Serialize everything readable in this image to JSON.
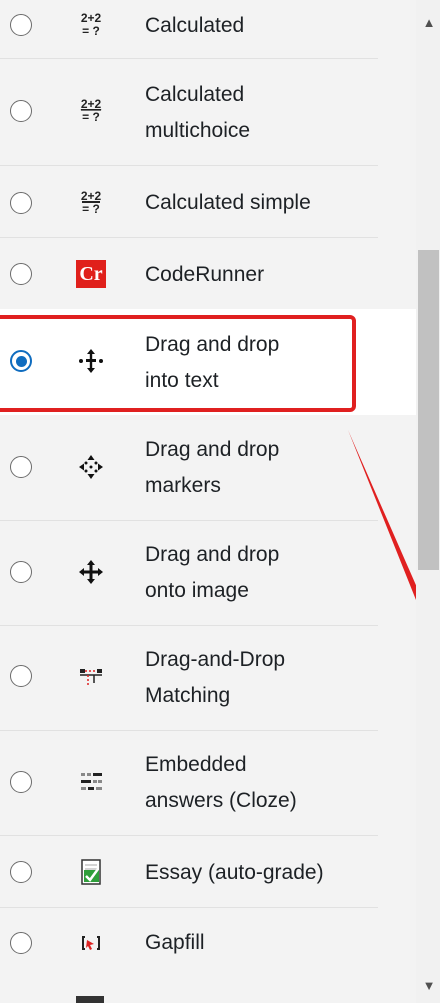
{
  "question_types": [
    {
      "label_lines": [
        "Calculated"
      ],
      "icon": "calculated-icon",
      "selected": false
    },
    {
      "label_lines": [
        "Calculated",
        "multichoice"
      ],
      "icon": "calculated-multichoice-icon",
      "selected": false
    },
    {
      "label_lines": [
        "Calculated simple"
      ],
      "icon": "calculated-simple-icon",
      "selected": false
    },
    {
      "label_lines": [
        "CodeRunner"
      ],
      "icon": "coderunner-icon",
      "selected": false,
      "icon_text": "Cr"
    },
    {
      "label_lines": [
        "Drag and drop",
        "into text"
      ],
      "icon": "drag-into-text-icon",
      "selected": true
    },
    {
      "label_lines": [
        "Drag and drop",
        "markers"
      ],
      "icon": "drag-markers-icon",
      "selected": false
    },
    {
      "label_lines": [
        "Drag and drop",
        "onto image"
      ],
      "icon": "drag-onto-image-icon",
      "selected": false
    },
    {
      "label_lines": [
        "Drag-and-Drop",
        "Matching"
      ],
      "icon": "drag-matching-icon",
      "selected": false
    },
    {
      "label_lines": [
        "Embedded",
        "answers (Cloze)"
      ],
      "icon": "cloze-icon",
      "selected": false
    },
    {
      "label_lines": [
        "Essay (auto-grade)"
      ],
      "icon": "essay-autograde-icon",
      "selected": false
    },
    {
      "label_lines": [
        "Gapfill"
      ],
      "icon": "gapfill-icon",
      "selected": false
    }
  ],
  "icon_texts": {
    "calculated_top": "2+2",
    "calculated_bottom": "= ?",
    "coderunner": "Cr"
  },
  "colors": {
    "selected_radio": "#0f6cbf",
    "highlight_border": "#e02020",
    "coderunner_bg": "#e0201b"
  }
}
